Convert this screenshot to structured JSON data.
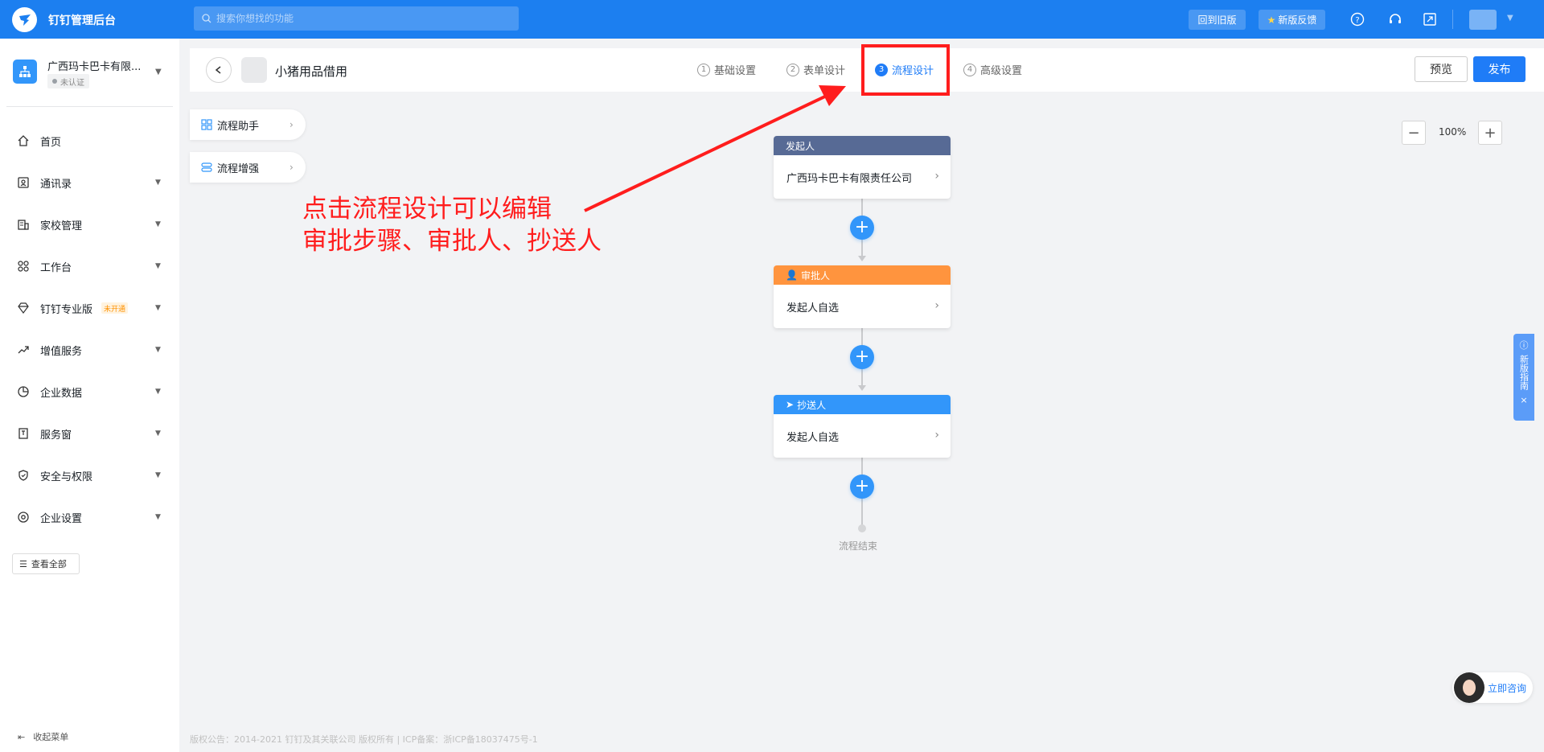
{
  "topbar": {
    "app_title": "钉钉管理后台",
    "search_placeholder": "搜索你想找的功能",
    "back_old_label": "回到旧版",
    "feedback_label": "新版反馈"
  },
  "sidebar": {
    "org_name": "广西玛卡巴卡有限...",
    "org_status": "未认证",
    "items": [
      {
        "label": "首页",
        "icon": "home-icon"
      },
      {
        "label": "通讯录",
        "icon": "contacts-icon"
      },
      {
        "label": "家校管理",
        "icon": "school-icon"
      },
      {
        "label": "工作台",
        "icon": "workbench-icon"
      },
      {
        "label": "钉钉专业版",
        "icon": "diamond-icon",
        "tag": "未开通"
      },
      {
        "label": "增值服务",
        "icon": "trend-icon"
      },
      {
        "label": "企业数据",
        "icon": "pie-chart-icon"
      },
      {
        "label": "服务窗",
        "icon": "service-window-icon"
      },
      {
        "label": "安全与权限",
        "icon": "shield-icon"
      },
      {
        "label": "企业设置",
        "icon": "settings-icon"
      }
    ],
    "view_all": "查看全部",
    "collapse": "收起菜单"
  },
  "header": {
    "form_title": "小猪用品借用",
    "steps": [
      {
        "num": "1",
        "label": "基础设置"
      },
      {
        "num": "2",
        "label": "表单设计"
      },
      {
        "num": "3",
        "label": "流程设计",
        "active": true
      },
      {
        "num": "4",
        "label": "高级设置"
      }
    ],
    "preview": "预览",
    "publish": "发布"
  },
  "left_panel": {
    "assistant": "流程助手",
    "enhance": "流程增强"
  },
  "zoom": {
    "value": "100%"
  },
  "flow": {
    "initiator": {
      "title": "发起人",
      "body": "广西玛卡巴卡有限责任公司",
      "color": "#576a95"
    },
    "approver": {
      "title": "审批人",
      "body": "发起人自选",
      "color": "#ff943e"
    },
    "cc": {
      "title": "抄送人",
      "body": "发起人自选",
      "color": "#3296fa"
    },
    "end": "流程结束"
  },
  "annotation": {
    "line1": "点击流程设计可以编辑",
    "line2": "审批步骤、审批人、抄送人"
  },
  "right": {
    "guide": "新版指南",
    "consult": "立即咨询"
  },
  "footer": "版权公告：2014-2021 钉钉及其关联公司 版权所有 | ICP备案：浙ICP备18037475号-1"
}
